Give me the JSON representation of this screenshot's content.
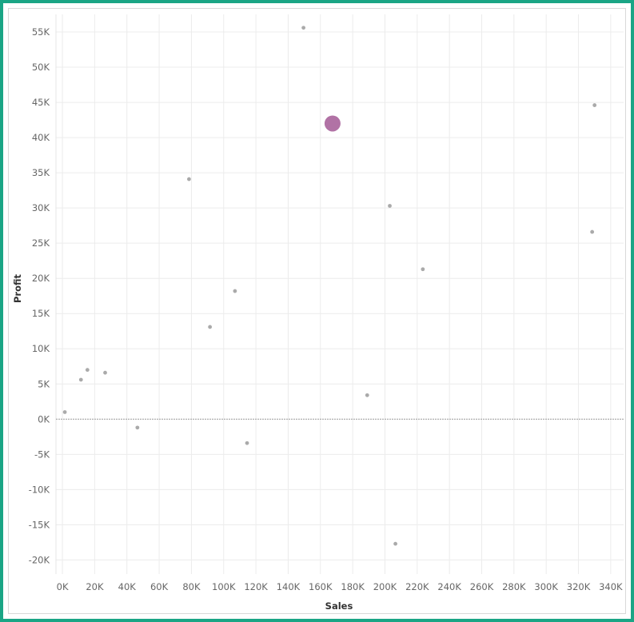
{
  "chart_data": {
    "type": "scatter",
    "title": "",
    "xlabel": "Sales",
    "ylabel": "Profit",
    "xlim": [
      -4000,
      348000
    ],
    "ylim": [
      -22000,
      57500
    ],
    "x_ticks": [
      0,
      20000,
      40000,
      60000,
      80000,
      100000,
      120000,
      140000,
      160000,
      180000,
      200000,
      220000,
      240000,
      260000,
      280000,
      300000,
      320000,
      340000
    ],
    "x_tick_labels": [
      "0K",
      "20K",
      "40K",
      "60K",
      "80K",
      "100K",
      "120K",
      "140K",
      "160K",
      "180K",
      "200K",
      "220K",
      "240K",
      "260K",
      "280K",
      "300K",
      "320K",
      "340K"
    ],
    "y_ticks": [
      -20000,
      -15000,
      -10000,
      -5000,
      0,
      5000,
      10000,
      15000,
      20000,
      25000,
      30000,
      35000,
      40000,
      45000,
      50000,
      55000
    ],
    "y_tick_labels": [
      "-20K",
      "-15K",
      "-10K",
      "-5K",
      "0K",
      "5K",
      "10K",
      "15K",
      "20K",
      "25K",
      "30K",
      "35K",
      "40K",
      "45K",
      "50K",
      "55K"
    ],
    "grid": true,
    "zero_line": true,
    "colors": {
      "point": "#aaaaaa",
      "highlight": "#a8639b",
      "grid": "#ececec",
      "zero_line": "#999999"
    },
    "points": [
      {
        "x": 1500,
        "y": 1000
      },
      {
        "x": 11500,
        "y": 5600
      },
      {
        "x": 15500,
        "y": 7000
      },
      {
        "x": 26500,
        "y": 6600
      },
      {
        "x": 46500,
        "y": -1200
      },
      {
        "x": 78500,
        "y": 34100
      },
      {
        "x": 91500,
        "y": 13100
      },
      {
        "x": 107000,
        "y": 18200
      },
      {
        "x": 114500,
        "y": -3400
      },
      {
        "x": 149500,
        "y": 55600
      },
      {
        "x": 167500,
        "y": 42000,
        "highlight": true
      },
      {
        "x": 189000,
        "y": 3400
      },
      {
        "x": 203000,
        "y": 30300
      },
      {
        "x": 206500,
        "y": -17700
      },
      {
        "x": 223500,
        "y": 21300
      },
      {
        "x": 328500,
        "y": 26600
      },
      {
        "x": 330000,
        "y": 44600
      }
    ]
  }
}
